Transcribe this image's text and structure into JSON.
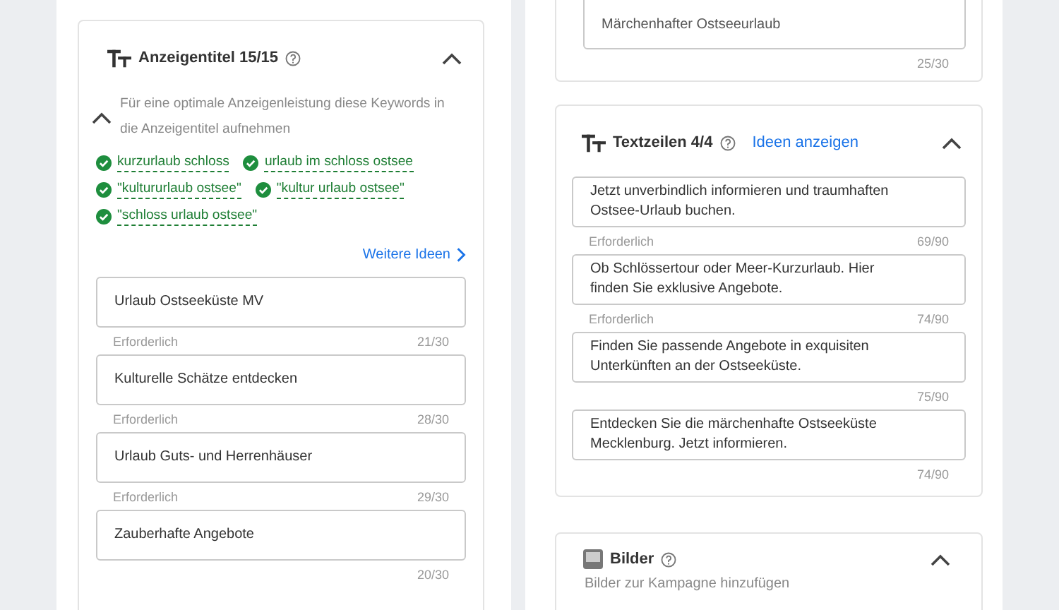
{
  "left_card": {
    "title": "Anzeigentitel 15/15",
    "expanded": true,
    "hint": {
      "text": "Für eine optimale Anzeigenleistung diese Keywords in die Anzeigentitel aufnehmen",
      "expanded": true
    },
    "keywords": [
      {
        "text": "kurzurlaub schloss",
        "checked": true
      },
      {
        "text": "urlaub im schloss ostsee",
        "checked": true
      },
      {
        "text": "\"kultururlaub ostsee\"",
        "checked": true
      },
      {
        "text": "\"kultur urlaub ostsee\"",
        "checked": true
      },
      {
        "text": "\"schloss urlaub ostsee\"",
        "checked": true
      }
    ],
    "more_link": "Weitere Ideen",
    "fields": [
      {
        "value": "Urlaub Ostseeküste MV",
        "helper": "Erforderlich",
        "counter": "21/30"
      },
      {
        "value": "Kulturelle Schätze entdecken",
        "helper": "Erforderlich",
        "counter": "28/30"
      },
      {
        "value": "Urlaub Guts- und Herrenhäuser",
        "helper": "Erforderlich",
        "counter": "29/30"
      },
      {
        "value": "Zauberhafte Angebote",
        "counter": "20/30"
      }
    ]
  },
  "right_top_card": {
    "fields": [
      {
        "value": "Märchenhafter Ostseeurlaub",
        "counter": "25/30"
      }
    ]
  },
  "right_card": {
    "title": "Textzeilen 4/4",
    "link": "Ideen anzeigen",
    "expanded": true,
    "fields": [
      {
        "value": "Jetzt unverbindlich informieren und traumhaften\nOstsee-Urlaub buchen.",
        "helper": "Erforderlich",
        "counter": "69/90"
      },
      {
        "value": "Ob Schlössertour oder Meer-Kurzurlaub. Hier\nfinden Sie exklusive Angebote.",
        "helper": "Erforderlich",
        "counter": "74/90"
      },
      {
        "value": "Finden Sie passende Angebote in exquisiten\nUnterkünften an der Ostseeküste.",
        "counter": "75/90"
      },
      {
        "value": "Entdecken Sie die märchenhafte Ostseeküste\nMecklenburg. Jetzt informieren.",
        "counter": "74/90"
      }
    ]
  },
  "bottom_card": {
    "title": "Bilder",
    "subtitle": "Bilder zur Kampagne hinzufügen",
    "expanded": true
  }
}
